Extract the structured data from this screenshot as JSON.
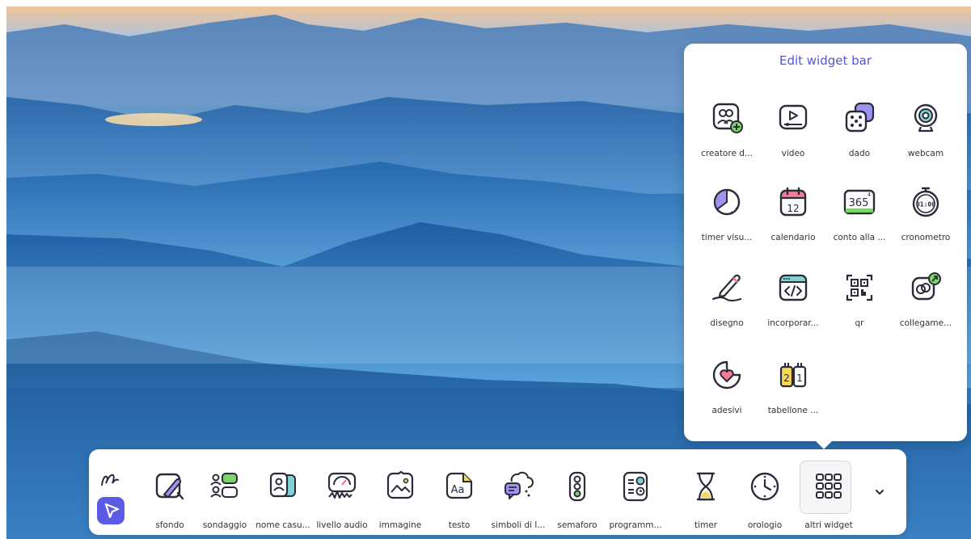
{
  "background": {
    "name": "mountain-landscape"
  },
  "widget_panel": {
    "title": "Edit widget bar",
    "widgets": [
      {
        "label": "creatore d...",
        "icon": "group-add-icon"
      },
      {
        "label": "video",
        "icon": "video-play-icon"
      },
      {
        "label": "dado",
        "icon": "dice-icon"
      },
      {
        "label": "webcam",
        "icon": "webcam-icon"
      },
      {
        "label": "timer visu...",
        "icon": "visual-timer-icon"
      },
      {
        "label": "calendario",
        "icon": "calendar-icon"
      },
      {
        "label": "conto alla ...",
        "icon": "countdown-365-icon"
      },
      {
        "label": "cronometro",
        "icon": "stopwatch-icon"
      },
      {
        "label": "disegno",
        "icon": "pen-draw-icon"
      },
      {
        "label": "incorporar...",
        "icon": "embed-code-icon"
      },
      {
        "label": "qr",
        "icon": "qr-code-icon"
      },
      {
        "label": "collegame...",
        "icon": "link-icon"
      },
      {
        "label": "adesivi",
        "icon": "heart-sticker-icon"
      },
      {
        "label": "tabellone ...",
        "icon": "scoreboard-icon"
      }
    ]
  },
  "dock": {
    "tools": [
      {
        "name": "draw-tool-icon"
      },
      {
        "name": "select-pointer-icon",
        "active": true
      }
    ],
    "items": [
      {
        "label": "sfondo",
        "icon": "background-paint-icon"
      },
      {
        "label": "sondaggio",
        "icon": "poll-icon"
      },
      {
        "label": "nome casu...",
        "icon": "random-name-icon"
      },
      {
        "label": "livello audio",
        "icon": "audio-level-icon"
      },
      {
        "label": "immagine",
        "icon": "image-icon"
      },
      {
        "label": "testo",
        "icon": "text-icon"
      },
      {
        "label": "simboli di l...",
        "icon": "symbols-chat-icon"
      },
      {
        "label": "semaforo",
        "icon": "traffic-light-icon"
      },
      {
        "label": "programm...",
        "icon": "schedule-icon"
      },
      {
        "label": "timer",
        "icon": "hourglass-icon"
      },
      {
        "label": "orologio",
        "icon": "clock-icon"
      },
      {
        "label": "altri widget",
        "icon": "grid-more-icon"
      }
    ],
    "more_icon": "chevron-down-icon"
  },
  "colors": {
    "accent": "#5b5be8",
    "title": "#5454e0",
    "icon_stroke": "#2b2b3a",
    "yellow": "#f5d75a",
    "green": "#7ed36c",
    "teal": "#7fd4d0",
    "purple": "#9d93f0",
    "pink": "#f47a96"
  }
}
